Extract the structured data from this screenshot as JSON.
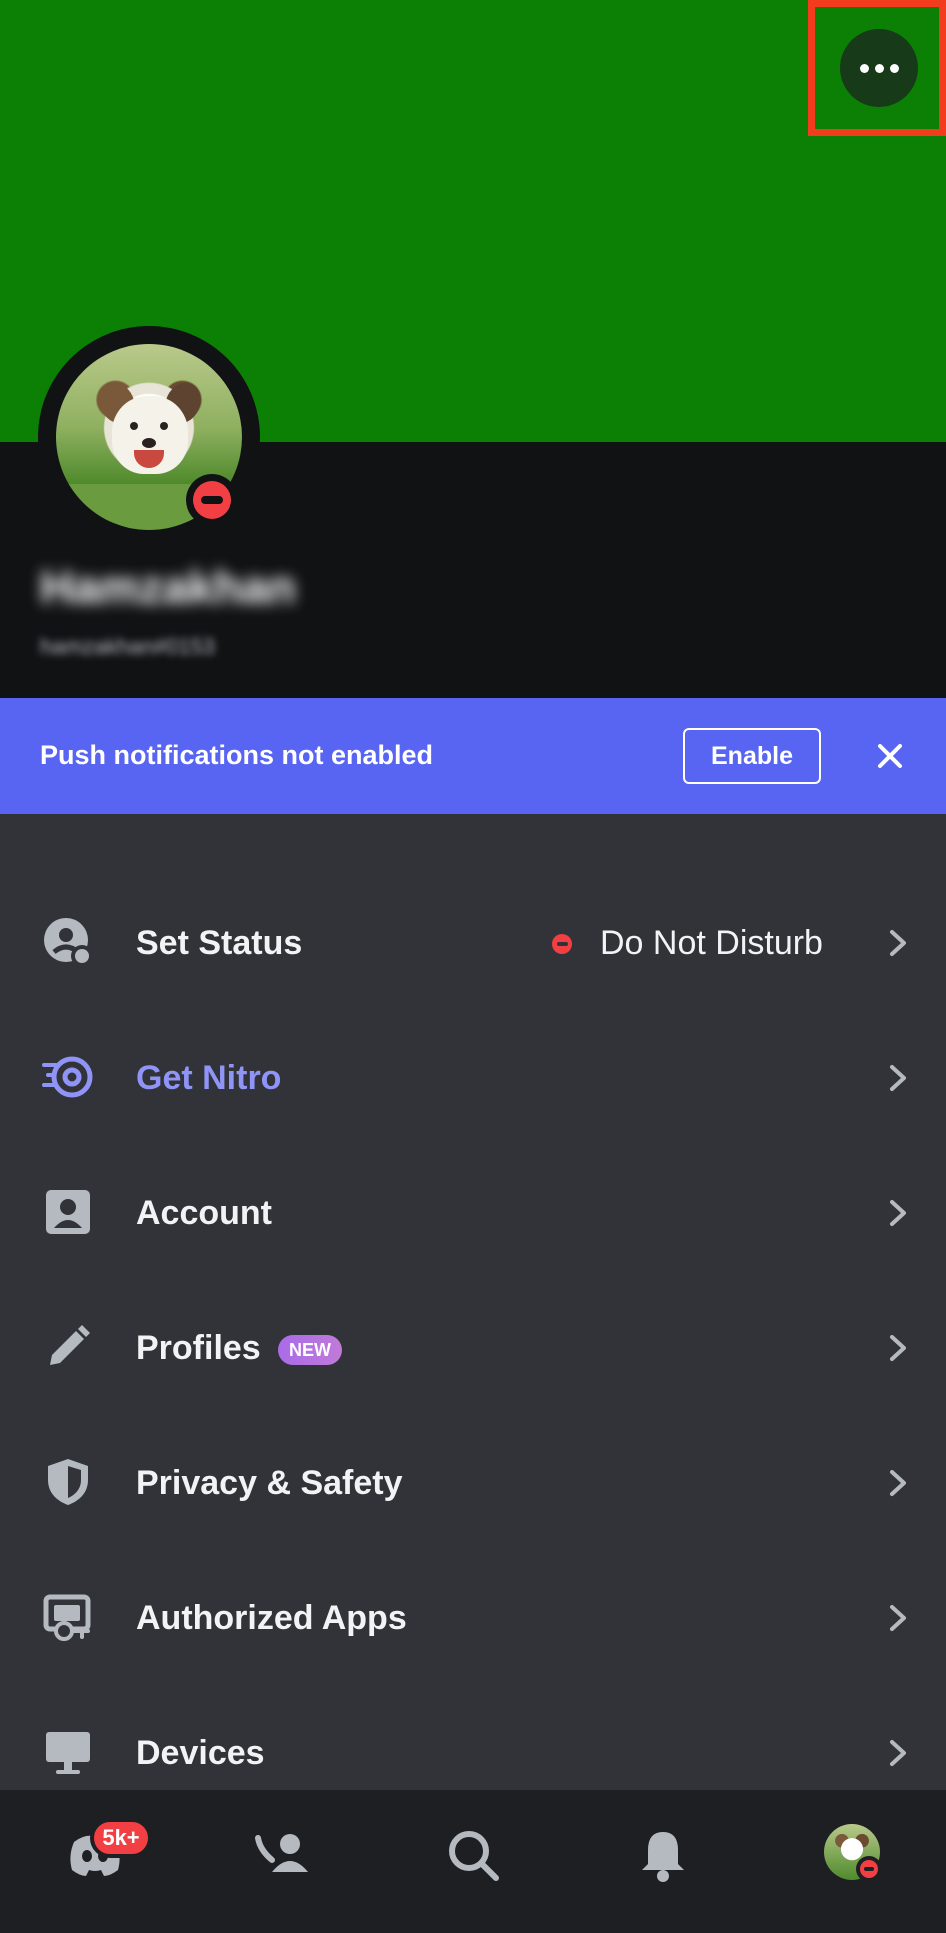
{
  "header": {
    "more_icon": "more-horizontal-icon",
    "banner_color": "#0b8005",
    "highlight_color": "#f23c1d"
  },
  "profile": {
    "display_name": "Hamzakhan",
    "username": "hamzakhan#0153",
    "status": "dnd"
  },
  "push_banner": {
    "text": "Push notifications not enabled",
    "enable_label": "Enable",
    "close_icon": "close-icon",
    "color": "#5865f2"
  },
  "settings": {
    "items": [
      {
        "label": "Set Status",
        "icon": "status-icon",
        "value": "Do Not Disturb"
      },
      {
        "label": "Get Nitro",
        "icon": "nitro-icon"
      },
      {
        "label": "Account",
        "icon": "account-icon"
      },
      {
        "label": "Profiles",
        "icon": "pencil-icon",
        "badge": "NEW"
      },
      {
        "label": "Privacy & Safety",
        "icon": "shield-icon"
      },
      {
        "label": "Authorized Apps",
        "icon": "authorized-apps-icon"
      },
      {
        "label": "Devices",
        "icon": "monitor-icon"
      }
    ]
  },
  "bottom_nav": {
    "items": [
      {
        "name": "servers",
        "icon": "discord-logo-icon",
        "badge": "5k+"
      },
      {
        "name": "friends",
        "icon": "friends-icon"
      },
      {
        "name": "search",
        "icon": "search-icon"
      },
      {
        "name": "notifications",
        "icon": "bell-icon"
      },
      {
        "name": "you",
        "icon": "avatar"
      }
    ]
  }
}
